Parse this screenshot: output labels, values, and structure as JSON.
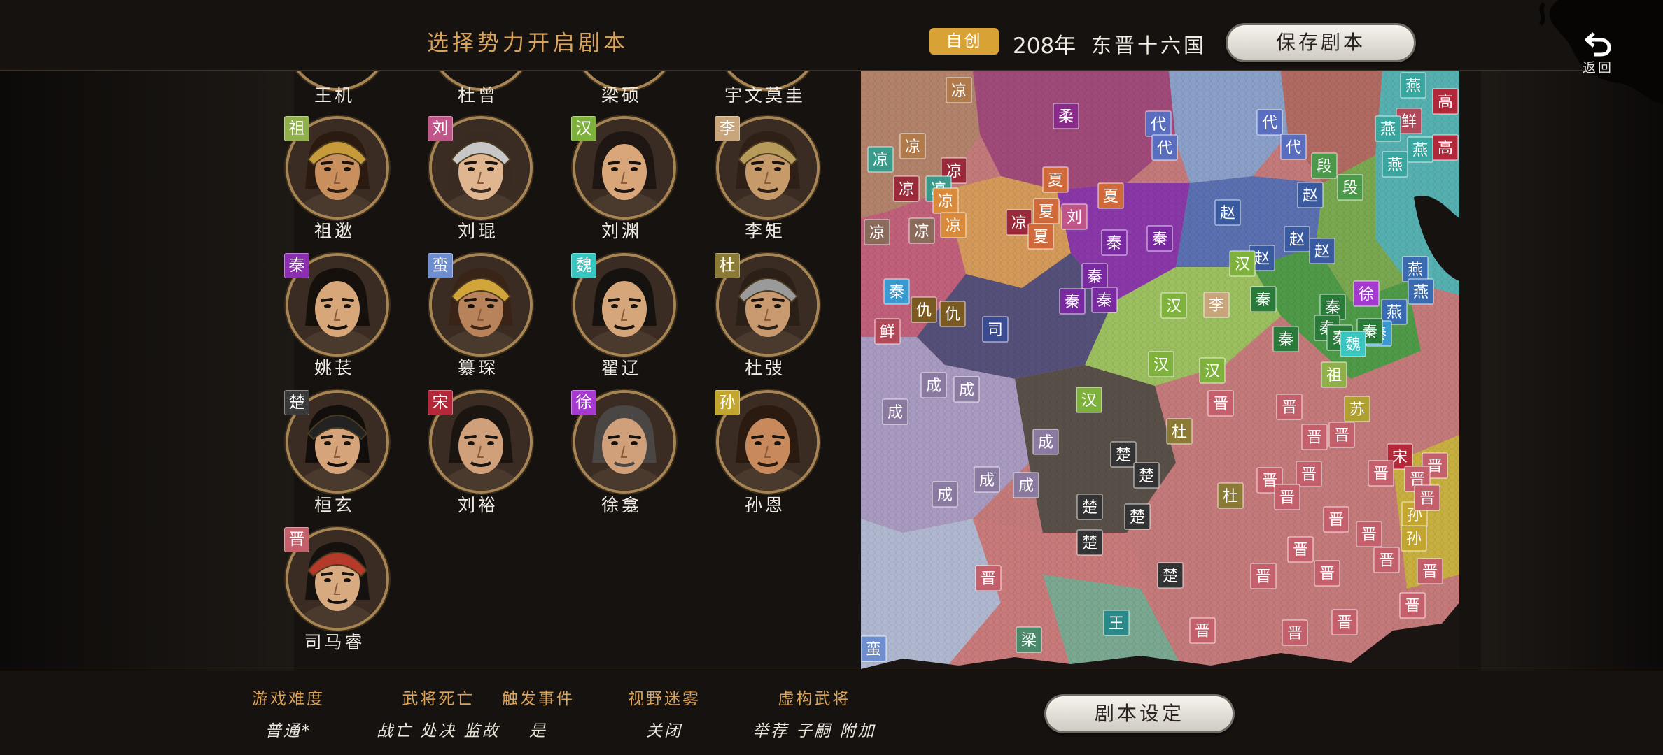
{
  "header": {
    "title": "选择势力开启剧本",
    "badge": "自创",
    "year": "208年",
    "era": "东晋十六国",
    "save_label": "保存剧本",
    "back_label": "返回"
  },
  "generals_top": [
    "王机",
    "杜曾",
    "梁硕",
    "宇文莫圭"
  ],
  "generals": [
    {
      "name": "祖逖",
      "tag": "祖",
      "color": "#8fb04a",
      "skin": "#c9905e",
      "hair": "#2a1a10",
      "helm": "#c79a3a"
    },
    {
      "name": "刘琨",
      "tag": "刘",
      "color": "#c0558a",
      "skin": "#e0b690",
      "hair": "#3a2b22",
      "helm": "#c7c7c7"
    },
    {
      "name": "刘渊",
      "tag": "汉",
      "color": "#7fb23c",
      "skin": "#d8a679",
      "hair": "#1e1612",
      "helm": ""
    },
    {
      "name": "李矩",
      "tag": "李",
      "color": "#c8a57a",
      "skin": "#c79a6a",
      "hair": "#2e2016",
      "helm": "#b59a5a"
    },
    {
      "name": "姚苌",
      "tag": "秦",
      "color": "#8b2fb0",
      "skin": "#d7a77a",
      "hair": "#15100c",
      "helm": ""
    },
    {
      "name": "纂琛",
      "tag": "蛮",
      "color": "#6f8ed0",
      "skin": "#b8835a",
      "hair": "#3a2418",
      "helm": "#d1a53a"
    },
    {
      "name": "翟辽",
      "tag": "魏",
      "color": "#38c7c0",
      "skin": "#d5a67a",
      "hair": "#161210",
      "helm": ""
    },
    {
      "name": "杜弢",
      "tag": "杜",
      "color": "#8a7a35",
      "skin": "#c99a70",
      "hair": "#2a2018",
      "helm": "#9a9a9a"
    },
    {
      "name": "桓玄",
      "tag": "楚",
      "color": "#3a3a3a",
      "skin": "#d6a47a",
      "hair": "#120e0c",
      "helm": "#222"
    },
    {
      "name": "刘裕",
      "tag": "宋",
      "color": "#b4283a",
      "skin": "#cfa07a",
      "hair": "#1b1512",
      "helm": ""
    },
    {
      "name": "徐龛",
      "tag": "徐",
      "color": "#a63ad0",
      "skin": "#d0a07a",
      "hair": "#4a4644",
      "helm": ""
    },
    {
      "name": "孙恩",
      "tag": "孙",
      "color": "#c2a630",
      "skin": "#c88a5c",
      "hair": "#2a1a10",
      "helm": ""
    },
    {
      "name": "司马睿",
      "tag": "晋",
      "color": "#c4606c",
      "skin": "#d8aa80",
      "hair": "#15110e",
      "helm": "#b53a2a"
    }
  ],
  "map": {
    "labels": [
      {
        "t": "凉",
        "c": "#b07a4a"
      },
      {
        "t": "柔",
        "c": "#8a2a8a"
      },
      {
        "t": "代",
        "c": "#5a6ec0"
      },
      {
        "t": "代",
        "c": "#5a6ec0"
      },
      {
        "t": "代",
        "c": "#5a6ec0"
      },
      {
        "t": "代",
        "c": "#5a6ec0"
      },
      {
        "t": "燕",
        "c": "#3aa6a0"
      },
      {
        "t": "高",
        "c": "#b0283a"
      },
      {
        "t": "鲜",
        "c": "#b04a5a"
      },
      {
        "t": "燕",
        "c": "#3aa6a0"
      },
      {
        "t": "高",
        "c": "#b0283a"
      },
      {
        "t": "燕",
        "c": "#3aa6a0"
      },
      {
        "t": "燕",
        "c": "#3aa6a0"
      },
      {
        "t": "凉",
        "c": "#3a9a8a"
      },
      {
        "t": "凉",
        "c": "#b07a4a"
      },
      {
        "t": "凉",
        "c": "#9a2a3a"
      },
      {
        "t": "凉",
        "c": "#9a2a3a"
      },
      {
        "t": "凉",
        "c": "#3a9a8a"
      },
      {
        "t": "凉",
        "c": "#d98a3a"
      },
      {
        "t": "夏",
        "c": "#d06a3a"
      },
      {
        "t": "夏",
        "c": "#d06a3a"
      },
      {
        "t": "刘",
        "c": "#c0558a"
      },
      {
        "t": "段",
        "c": "#4a9a4a"
      },
      {
        "t": "段",
        "c": "#4a9a4a"
      },
      {
        "t": "赵",
        "c": "#3a5aa0"
      },
      {
        "t": "赵",
        "c": "#3a5aa0"
      },
      {
        "t": "凉",
        "c": "#8a6a5a"
      },
      {
        "t": "凉",
        "c": "#8a6a5a"
      },
      {
        "t": "凉",
        "c": "#d98a3a"
      },
      {
        "t": "凉",
        "c": "#9a2a3a"
      },
      {
        "t": "夏",
        "c": "#d06a3a"
      },
      {
        "t": "夏",
        "c": "#d06a3a"
      },
      {
        "t": "秦",
        "c": "#7a2aa0"
      },
      {
        "t": "秦",
        "c": "#7a2aa0"
      },
      {
        "t": "赵",
        "c": "#3a5aa0"
      },
      {
        "t": "赵",
        "c": "#3a5aa0"
      },
      {
        "t": "赵",
        "c": "#3a5aa0"
      },
      {
        "t": "汉",
        "c": "#7fb23c"
      },
      {
        "t": "燕",
        "c": "#3a6ab0"
      },
      {
        "t": "秦",
        "c": "#3a9ad0"
      },
      {
        "t": "秦",
        "c": "#7a2aa0"
      },
      {
        "t": "秦",
        "c": "#7a2aa0"
      },
      {
        "t": "秦",
        "c": "#7a2aa0"
      },
      {
        "t": "汉",
        "c": "#7fb23c"
      },
      {
        "t": "李",
        "c": "#c8a57a"
      },
      {
        "t": "徐",
        "c": "#a63ad0"
      },
      {
        "t": "秦",
        "c": "#2a7a3a"
      },
      {
        "t": "秦",
        "c": "#2a7a3a"
      },
      {
        "t": "燕",
        "c": "#3a6ab0"
      },
      {
        "t": "燕",
        "c": "#3a6ab0"
      },
      {
        "t": "秦",
        "c": "#3a9ad0"
      },
      {
        "t": "仇",
        "c": "#7a5a20"
      },
      {
        "t": "仇",
        "c": "#7a5a20"
      },
      {
        "t": "鲜",
        "c": "#b04a5a"
      },
      {
        "t": "司",
        "c": "#3a4a90"
      },
      {
        "t": "秦",
        "c": "#2a7a3a"
      },
      {
        "t": "秦",
        "c": "#2a7a3a"
      },
      {
        "t": "秦",
        "c": "#2a7a3a"
      },
      {
        "t": "秦",
        "c": "#2a7a3a"
      },
      {
        "t": "魏",
        "c": "#38c7c0"
      },
      {
        "t": "汉",
        "c": "#7fb23c"
      },
      {
        "t": "汉",
        "c": "#7fb23c"
      },
      {
        "t": "祖",
        "c": "#8fb04a"
      },
      {
        "t": "成",
        "c": "#8a7aa0"
      },
      {
        "t": "成",
        "c": "#8a7aa0"
      },
      {
        "t": "成",
        "c": "#8a7aa0"
      },
      {
        "t": "汉",
        "c": "#7fb23c"
      },
      {
        "t": "晋",
        "c": "#c4606c"
      },
      {
        "t": "晋",
        "c": "#c4606c"
      },
      {
        "t": "苏",
        "c": "#b0a030"
      },
      {
        "t": "晋",
        "c": "#c4606c"
      },
      {
        "t": "杜",
        "c": "#8a7a35"
      },
      {
        "t": "晋",
        "c": "#c4606c"
      },
      {
        "t": "晋",
        "c": "#c4606c"
      },
      {
        "t": "成",
        "c": "#8a7aa0"
      },
      {
        "t": "楚",
        "c": "#333333"
      },
      {
        "t": "楚",
        "c": "#333333"
      },
      {
        "t": "宋",
        "c": "#b4283a"
      },
      {
        "t": "晋",
        "c": "#c4606c"
      },
      {
        "t": "晋",
        "c": "#c4606c"
      },
      {
        "t": "晋",
        "c": "#c4606c"
      },
      {
        "t": "成",
        "c": "#8a7aa0"
      },
      {
        "t": "成",
        "c": "#8a7aa0"
      },
      {
        "t": "成",
        "c": "#8a7aa0"
      },
      {
        "t": "杜",
        "c": "#8a7a35"
      },
      {
        "t": "晋",
        "c": "#c4606c"
      },
      {
        "t": "晋",
        "c": "#c4606c"
      },
      {
        "t": "孙",
        "c": "#c2a630"
      },
      {
        "t": "晋",
        "c": "#c4606c"
      },
      {
        "t": "楚",
        "c": "#333333"
      },
      {
        "t": "楚",
        "c": "#333333"
      },
      {
        "t": "晋",
        "c": "#c4606c"
      },
      {
        "t": "晋",
        "c": "#c4606c"
      },
      {
        "t": "孙",
        "c": "#c2a630"
      },
      {
        "t": "晋",
        "c": "#c4606c"
      },
      {
        "t": "楚",
        "c": "#333333"
      },
      {
        "t": "晋",
        "c": "#c4606c"
      },
      {
        "t": "晋",
        "c": "#c4606c"
      },
      {
        "t": "晋",
        "c": "#c4606c"
      },
      {
        "t": "晋",
        "c": "#c4606c"
      },
      {
        "t": "楚",
        "c": "#333333"
      },
      {
        "t": "晋",
        "c": "#c4606c"
      },
      {
        "t": "晋",
        "c": "#c4606c"
      },
      {
        "t": "晋",
        "c": "#c4606c"
      },
      {
        "t": "王",
        "c": "#2a8a8a"
      },
      {
        "t": "晋",
        "c": "#c4606c"
      },
      {
        "t": "梁",
        "c": "#4a8a6a"
      },
      {
        "t": "晋",
        "c": "#c4606c"
      },
      {
        "t": "蛮",
        "c": "#6f8ed0"
      }
    ]
  },
  "settings": [
    {
      "key": "游戏难度",
      "value": "普通*"
    },
    {
      "key": "武将死亡",
      "value": "战亡 处决 监故"
    },
    {
      "key": "触发事件",
      "value": "是"
    },
    {
      "key": "视野迷雾",
      "value": "关闭"
    },
    {
      "key": "虚构武将",
      "value": "举荐 子嗣 附加"
    }
  ],
  "footer": {
    "script_settings_label": "剧本设定"
  }
}
